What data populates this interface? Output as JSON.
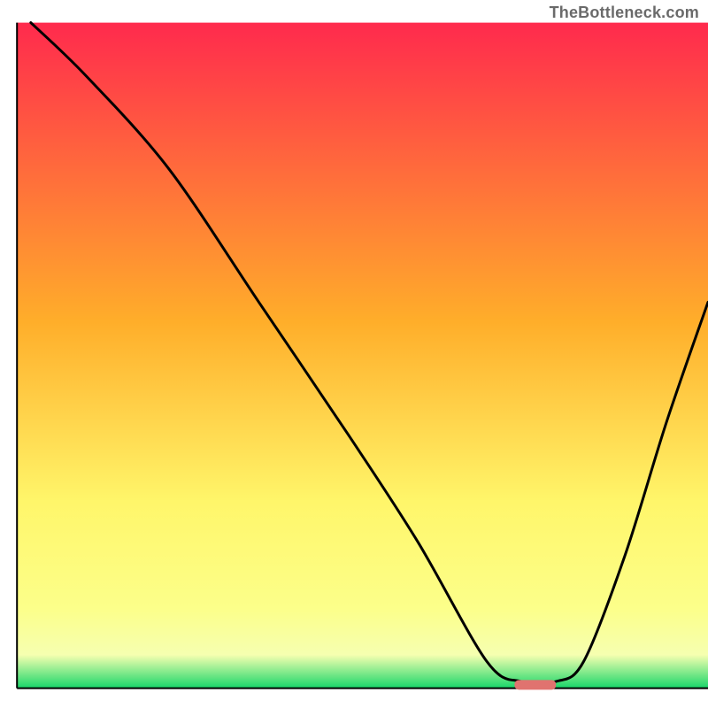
{
  "watermark_text": "TheBottleneck.com",
  "chart_data": {
    "type": "line",
    "title": "",
    "xlabel": "",
    "ylabel": "",
    "xlim": [
      0,
      100
    ],
    "ylim": [
      0,
      100
    ],
    "background_gradient": {
      "top_color": "#ff2a4d",
      "mid_color": "#ffc32a",
      "lower_yellow": "#fff66a",
      "near_bottom": "#f6ffb0",
      "bottom_color": "#18d66a"
    },
    "series": [
      {
        "name": "bottleneck-curve",
        "x": [
          2,
          10,
          22,
          35,
          48,
          58,
          68,
          73,
          78,
          82,
          88,
          94,
          100
        ],
        "y_pct": [
          100,
          92,
          78,
          58,
          38,
          22,
          4,
          1,
          1,
          4,
          20,
          40,
          58
        ]
      }
    ],
    "marker": {
      "name": "optimal-marker",
      "x_pct": 75,
      "y_pct": 0.5,
      "width_pct": 6,
      "color": "#e0736f"
    },
    "frame": {
      "top_y_pct": 3.2,
      "bottom_y_pct": 97.2,
      "left_x_pct": 2.4,
      "right_x_pct": 100
    }
  }
}
